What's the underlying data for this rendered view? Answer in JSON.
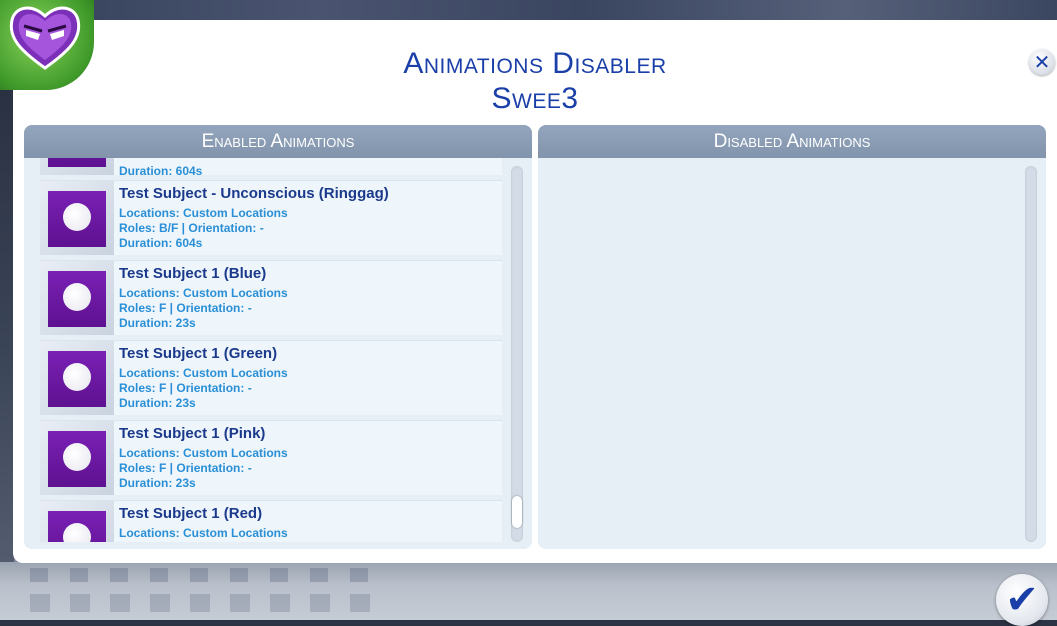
{
  "dialog": {
    "title_line1": "Animations Disabler",
    "title_line2": "Swee3",
    "close_glyph": "✕",
    "confirm_glyph": "✔"
  },
  "enabled_panel": {
    "header": "Enabled Animations",
    "partial_top_duration": "Duration: 604s",
    "items": [
      {
        "name": "Test Subject - Unconscious (Ringgag)",
        "locations": "Locations: Custom Locations",
        "roles": "Roles: B/F | Orientation: -",
        "duration": "Duration: 604s"
      },
      {
        "name": "Test Subject 1 (Blue)",
        "locations": "Locations: Custom Locations",
        "roles": "Roles: F | Orientation: -",
        "duration": "Duration: 23s"
      },
      {
        "name": "Test Subject 1 (Green)",
        "locations": "Locations: Custom Locations",
        "roles": "Roles: F | Orientation: -",
        "duration": "Duration: 23s"
      },
      {
        "name": "Test Subject 1 (Pink)",
        "locations": "Locations: Custom Locations",
        "roles": "Roles: F | Orientation: -",
        "duration": "Duration: 23s"
      },
      {
        "name": "Test Subject 1 (Red)",
        "locations": "Locations: Custom Locations",
        "roles": "",
        "duration": ""
      }
    ]
  },
  "disabled_panel": {
    "header": "Disabled Animations"
  },
  "colors": {
    "title": "#1a3fa8",
    "item_name": "#1b3a8c",
    "item_meta": "#2a8fd6",
    "thumb": "#6d1aa3",
    "panel_header": "#8a9db5"
  },
  "icons": {
    "avatar": "purple-heart-face-icon",
    "close": "close-icon",
    "confirm": "checkmark-icon",
    "thumb": "animation-thumbnail-icon"
  }
}
